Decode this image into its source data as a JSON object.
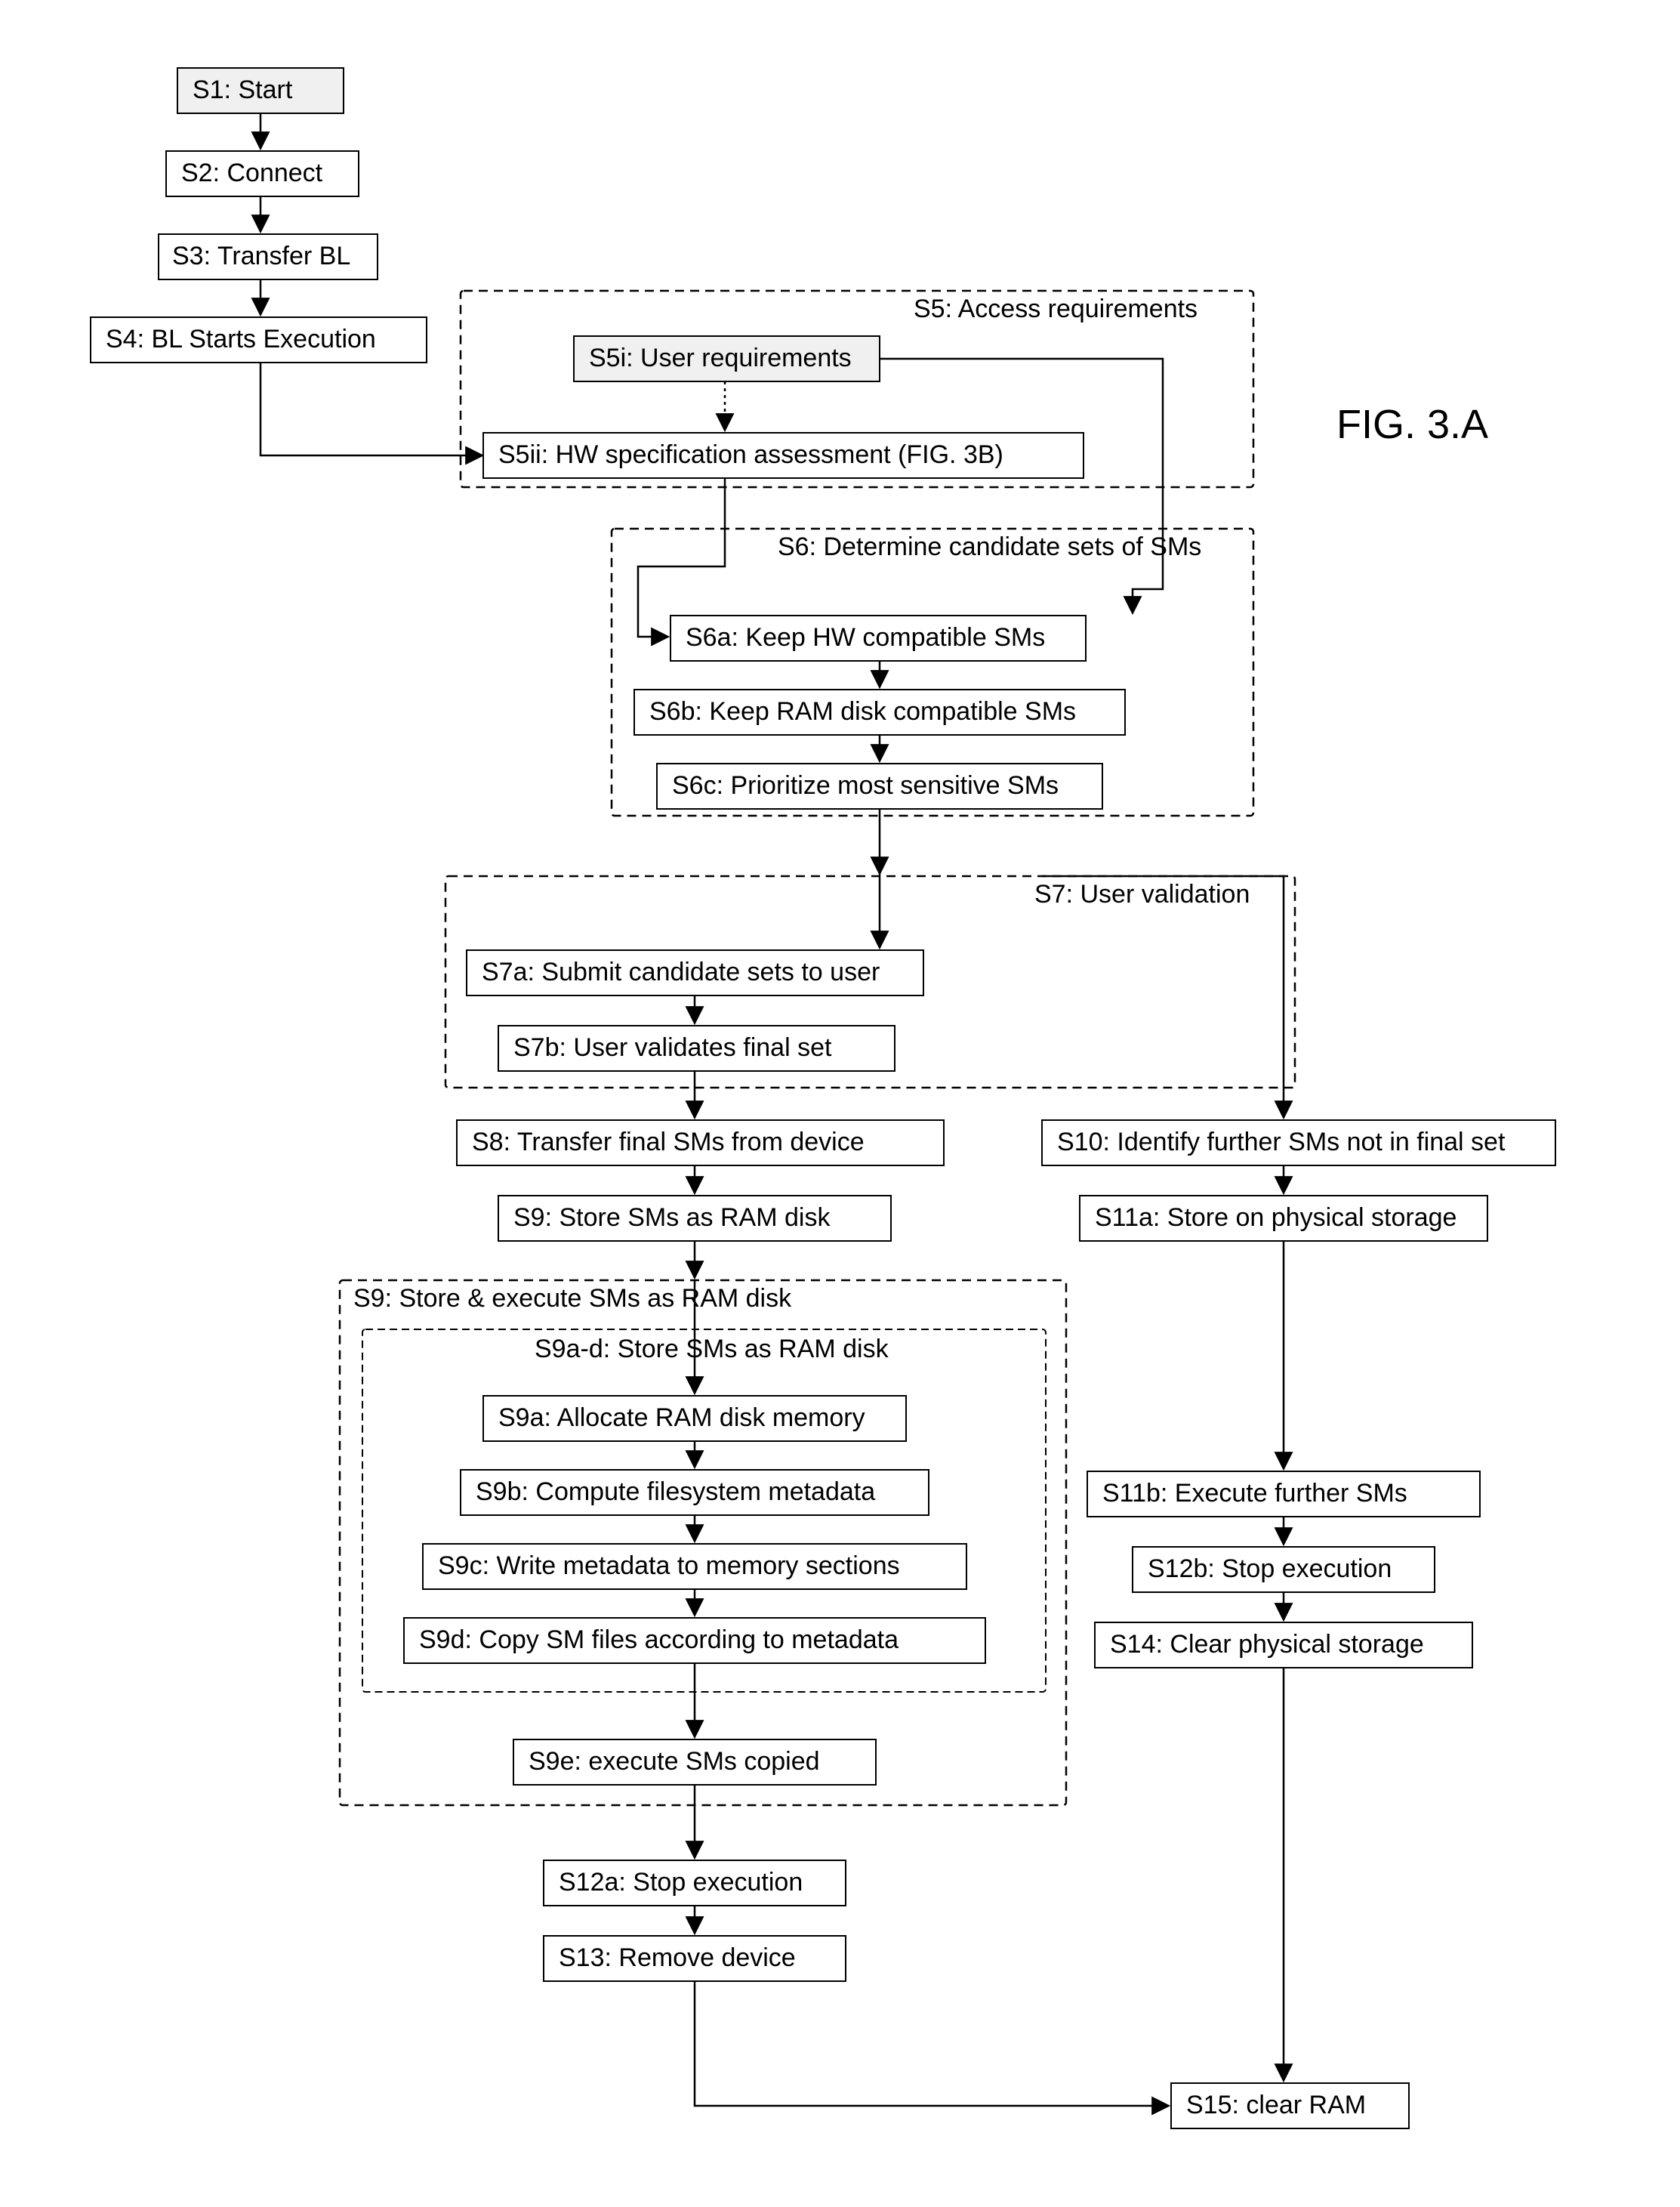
{
  "figureLabel": "FIG. 3.A",
  "nodes": {
    "s1": "S1: Start",
    "s2": "S2: Connect",
    "s3": "S3: Transfer BL",
    "s4": "S4: BL Starts Execution",
    "s5": "S5: Access requirements",
    "s5i": "S5i: User requirements",
    "s5ii": "S5ii: HW specification assessment (FIG. 3B)",
    "s6": "S6: Determine candidate sets of SMs",
    "s6a": "S6a: Keep HW compatible SMs",
    "s6b": "S6b: Keep RAM disk compatible SMs",
    "s6c": "S6c: Prioritize most sensitive SMs",
    "s7": "S7: User validation",
    "s7a": "S7a: Submit candidate sets to user",
    "s7b": "S7b: User validates final set",
    "s8": "S8: Transfer final SMs from device",
    "s9top": "S9: Store SMs as RAM disk",
    "s9group": "S9: Store & execute SMs as RAM disk",
    "s9sub": "S9a-d: Store SMs as RAM disk",
    "s9a": "S9a: Allocate RAM disk memory",
    "s9b": "S9b: Compute filesystem metadata",
    "s9c": "S9c: Write metadata to memory sections",
    "s9d": "S9d: Copy SM files according to metadata",
    "s9e": "S9e: execute SMs copied",
    "s10": "S10: Identify further SMs not in final set",
    "s11a": "S11a: Store on physical storage",
    "s11b": "S11b: Execute further SMs",
    "s12a": "S12a: Stop execution",
    "s12b": "S12b: Stop execution",
    "s13": "S13: Remove device",
    "s14": "S14: Clear physical storage",
    "s15": "S15: clear RAM"
  }
}
